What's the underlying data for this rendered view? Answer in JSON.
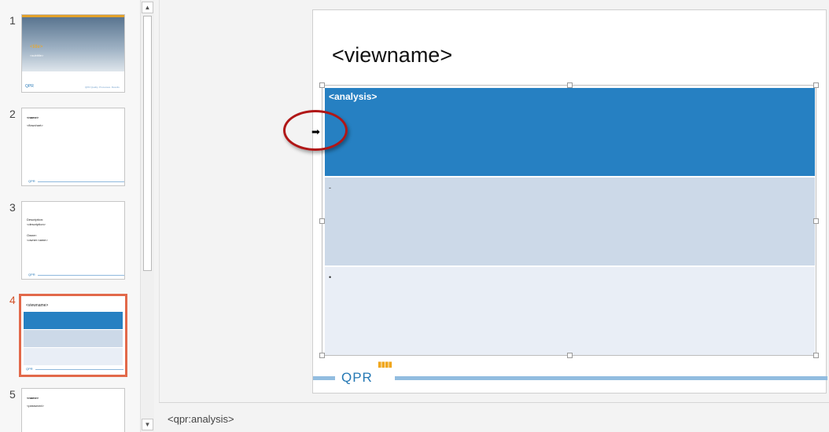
{
  "thumbnails": [
    {
      "number": "1",
      "title": "<title>",
      "subtitle": "<subtitle>",
      "footer_text": "QPR  Quality. Processes. Results.",
      "logo": "QPR"
    },
    {
      "number": "2",
      "name": "<name>",
      "line1": "<flowchart>",
      "logo": "QPR"
    },
    {
      "number": "3",
      "line1": "Description:",
      "line2": "<description>",
      "line3": "Owner:",
      "line4": "<owner name>",
      "logo": "QPR"
    },
    {
      "number": "4",
      "title": "<viewname>",
      "logo": "QPR"
    },
    {
      "number": "5",
      "name": "<name>",
      "line1": "<password>"
    }
  ],
  "slide": {
    "title": "<viewname>",
    "analysis_label": "<analysis>",
    "bullet_1": "-",
    "bullet_2": "•",
    "logo": "QPR",
    "logo_bars": "▮▮▮▮"
  },
  "cursor": {
    "glyph": "➡"
  },
  "notes": {
    "text": "<qpr:analysis>"
  },
  "scrollbar": {
    "up": "▲",
    "down": "▼"
  },
  "colors": {
    "accent": "#e2694a",
    "band_dark": "#2680c2",
    "band_mid": "#ccd9e8",
    "band_light": "#e9eef6",
    "circle": "#b01717"
  }
}
